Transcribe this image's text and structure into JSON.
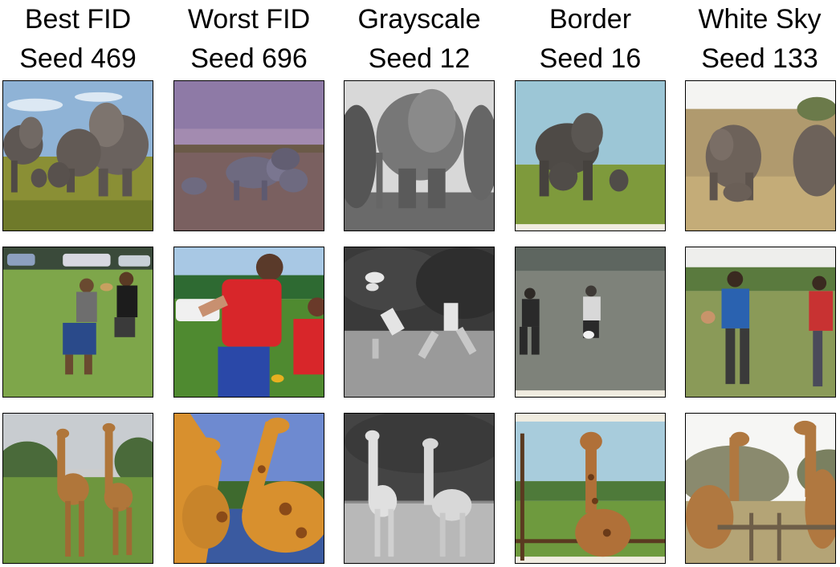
{
  "columns": [
    {
      "title": "Best FID",
      "seed": "Seed 469"
    },
    {
      "title": "Worst FID",
      "seed": "Seed 696"
    },
    {
      "title": "Grayscale",
      "seed": "Seed 12"
    },
    {
      "title": "Border",
      "seed": "Seed 16"
    },
    {
      "title": "White Sky",
      "seed": "Seed 133"
    }
  ],
  "rows": [
    {
      "subject": "elephants"
    },
    {
      "subject": "frisbee-players"
    },
    {
      "subject": "giraffes"
    }
  ]
}
